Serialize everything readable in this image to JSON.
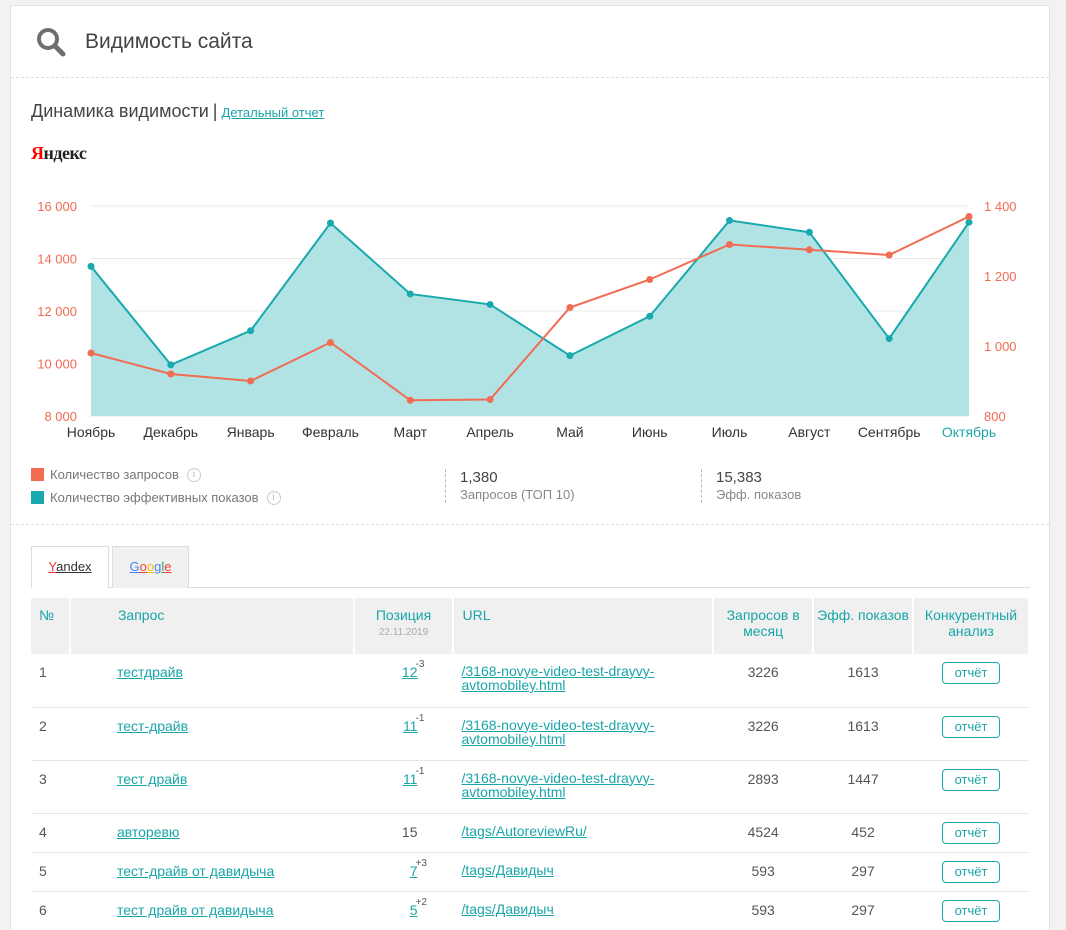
{
  "header": {
    "title": "Видимость сайта",
    "icon": "search-icon"
  },
  "section": {
    "title": "Динамика видимости",
    "separator": "|",
    "link": "Детальный отчет"
  },
  "logo": {
    "first": "Я",
    "rest": "ндекс"
  },
  "chart_data": {
    "type": "line",
    "categories": [
      "Ноябрь",
      "Декабрь",
      "Январь",
      "Февраль",
      "Март",
      "Апрель",
      "Май",
      "Июнь",
      "Июль",
      "Август",
      "Сентябрь",
      "Октябрь"
    ],
    "highlight_category": "Октябрь",
    "left_axis": {
      "ticks": [
        8000,
        10000,
        12000,
        14000,
        16000
      ],
      "labels": [
        "8 000",
        "10 000",
        "12 000",
        "14 000",
        "16 000"
      ],
      "ylim": [
        8000,
        16000
      ],
      "color": "#f26b53"
    },
    "right_axis": {
      "ticks": [
        800,
        1000,
        1200,
        1400
      ],
      "labels": [
        "800",
        "1 000",
        "1 200",
        "1 400"
      ],
      "ylim": [
        800,
        1400
      ],
      "color": "#f26b53"
    },
    "grid": true,
    "series": [
      {
        "name": "Количество запросов",
        "axis": "right",
        "type": "line",
        "color": "#f26b53",
        "values": [
          980,
          920,
          900,
          1010,
          845,
          847,
          1110,
          1190,
          1290,
          1275,
          1260,
          1370
        ]
      },
      {
        "name": "Количество эффективных показов",
        "axis": "left",
        "type": "area",
        "color": "#17a9ad",
        "fill": "#b1e3e4",
        "values": [
          13700,
          9950,
          11250,
          15350,
          12650,
          12250,
          10300,
          11800,
          15450,
          15000,
          10950,
          15383
        ]
      }
    ]
  },
  "legend": [
    {
      "label": "Количество запросов",
      "color": "#f26b53",
      "info": "i"
    },
    {
      "label": "Количество эффективных показов",
      "color": "#17a9ad",
      "info": "i"
    }
  ],
  "stats": [
    {
      "value": "1,380",
      "label": "Запросов (ТОП 10)"
    },
    {
      "value": "15,383",
      "label": "Эфф. показов"
    }
  ],
  "tabs": {
    "yandex": {
      "first": "Y",
      "rest": "andex"
    },
    "google": {
      "letters": [
        "G",
        "o",
        "o",
        "g",
        "l",
        "e"
      ],
      "colors": [
        "#4285f4",
        "#ea4335",
        "#fbbc05",
        "#4285f4",
        "#34a853",
        "#ea4335"
      ]
    }
  },
  "table": {
    "headers": {
      "num": "№",
      "query": "Запрос",
      "position": "Позиция",
      "position_date": "22.11.2019",
      "url": "URL",
      "requests": "Запросов в месяц",
      "effective": "Эфф. показов",
      "competitive": "Конкурентный анализ"
    },
    "rows": [
      {
        "num": "1",
        "query": "тестдрайв",
        "position": "12",
        "delta": "-3",
        "url": "/3168-novye-video-test-drayvy-avtomobiley.html",
        "requests": "3226",
        "effective": "1613",
        "action": "отчёт"
      },
      {
        "num": "2",
        "query": "тест-драйв",
        "position": "11",
        "delta": "-1",
        "url": "/3168-novye-video-test-drayvy-avtomobiley.html",
        "requests": "3226",
        "effective": "1613",
        "action": "отчёт"
      },
      {
        "num": "3",
        "query": "тест драйв",
        "position": "11",
        "delta": "-1",
        "url": "/3168-novye-video-test-drayvy-avtomobiley.html",
        "requests": "2893",
        "effective": "1447",
        "action": "отчёт"
      },
      {
        "num": "4",
        "query": "авторевю",
        "position": "15",
        "delta": "",
        "url": "/tags/AutoreviewRu/",
        "requests": "4524",
        "effective": "452",
        "action": "отчёт"
      },
      {
        "num": "5",
        "query": "тест-драйв от давидыча",
        "position": "7",
        "delta": "+3",
        "url": "/tags/Давидыч",
        "requests": "593",
        "effective": "297",
        "action": "отчёт"
      },
      {
        "num": "6",
        "query": "тест драйв от давидыча",
        "position": "5",
        "delta": "+2",
        "url": "/tags/Давидыч",
        "requests": "593",
        "effective": "297",
        "action": "отчёт"
      }
    ]
  }
}
